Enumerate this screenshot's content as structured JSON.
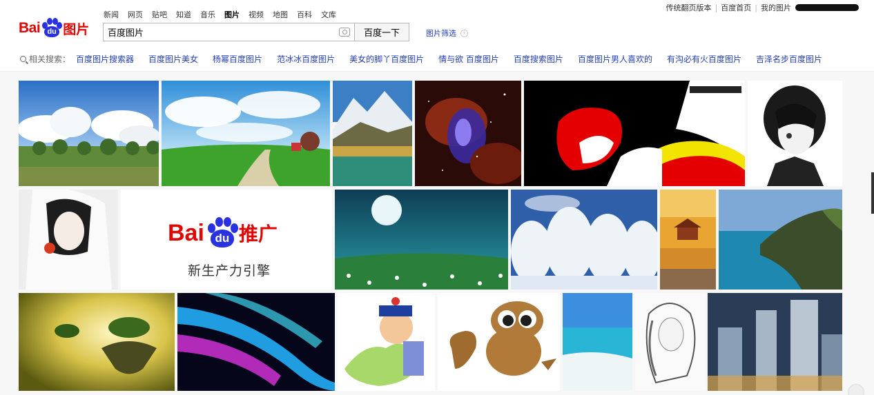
{
  "top_links": [
    "传统翻页版本",
    "百度首页",
    "我的图片"
  ],
  "logo": {
    "bai": "Bai",
    "du": "du",
    "pic": "图片"
  },
  "nav": [
    "新闻",
    "网页",
    "贴吧",
    "知道",
    "音乐",
    "图片",
    "视频",
    "地图",
    "百科",
    "文库"
  ],
  "nav_active": "图片",
  "search": {
    "value": "百度图片",
    "button": "百度一下",
    "camera_icon": "camera-icon"
  },
  "filter": {
    "label": "图片筛选",
    "icon": "chevron-right-icon"
  },
  "related": {
    "label": "相关搜索：",
    "items": [
      "百度图片搜索器",
      "百度图片美女",
      "杨幂百度图片",
      "范冰冰百度图片",
      "美女的脚丫百度图片",
      "情与欲 百度图片",
      "百度搜索图片",
      "百度图片男人喜欢的",
      "有沟必有火百度图片",
      "吉泽名步百度图片"
    ]
  },
  "ad_tile": {
    "brand": "Bai",
    "du": "du",
    "product": "推广",
    "slogan": "新生产力引擎"
  },
  "colors": {
    "brand_red": "#e10601",
    "brand_blue": "#2932e1",
    "link_blue": "#2440b3"
  }
}
